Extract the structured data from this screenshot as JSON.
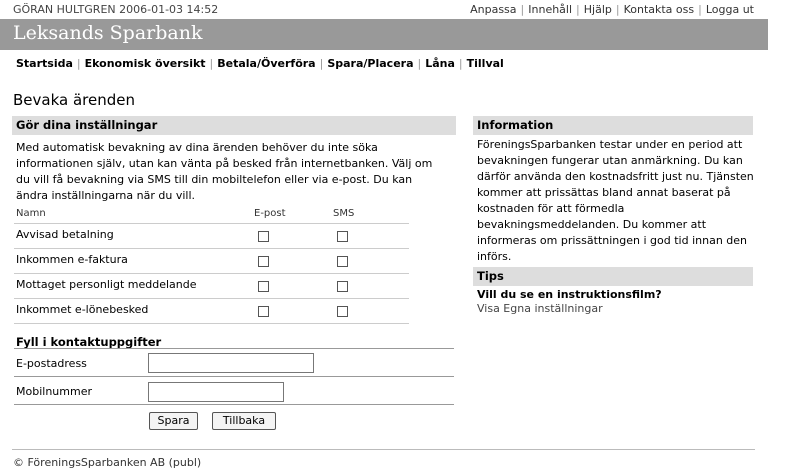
{
  "header": {
    "user_line": "GÖRAN HULTGREN 2006-01-03 14:52",
    "top_links": [
      "Anpassa",
      "Innehåll",
      "Hjälp",
      "Kontakta oss",
      "Logga ut"
    ],
    "brand": "Leksands Sparbank"
  },
  "nav": [
    "Startsida",
    "Ekonomisk översikt",
    "Betala/Överföra",
    "Spara/Placera",
    "Låna",
    "Tillval"
  ],
  "page_title": "Bevaka ärenden",
  "settings": {
    "heading": "Gör dina inställningar",
    "intro": "Med automatisk bevakning av dina ärenden behöver du inte söka informationen själv, utan kan vänta på besked från internetbanken. Välj om du vill få bevakning via SMS till din mobiltelefon eller via e-post. Du kan ändra inställningarna när du vill.",
    "col_name": "Namn",
    "col_email": "E-post",
    "col_sms": "SMS",
    "rows": [
      {
        "label": "Avvisad betalning",
        "email": false,
        "sms": false
      },
      {
        "label": "Inkommen e-faktura",
        "email": false,
        "sms": false
      },
      {
        "label": "Mottaget personligt meddelande",
        "email": false,
        "sms": false
      },
      {
        "label": "Inkommet e-lönebesked",
        "email": false,
        "sms": false
      }
    ]
  },
  "contact": {
    "heading": "Fyll i kontaktuppgifter",
    "email_label": "E-postadress",
    "email_value": "",
    "mobile_label": "Mobilnummer",
    "mobile_value": "",
    "save_label": "Spara",
    "back_label": "Tillbaka"
  },
  "information": {
    "heading": "Information",
    "text": "FöreningsSparbanken testar under en period att bevakningen fungerar utan anmärkning. Du kan därför använda den kostnadsfritt just nu. Tjänsten kommer att prissättas bland annat baserat på kostnaden för att förmedla bevakningsmeddelanden. Du kommer att informeras om prissättningen i god tid innan den införs."
  },
  "tips": {
    "heading": "Tips",
    "question": "Vill du se en instruktionsfilm?",
    "link": "Visa Egna inställningar"
  },
  "footer": "© FöreningsSparbanken AB (publ)"
}
